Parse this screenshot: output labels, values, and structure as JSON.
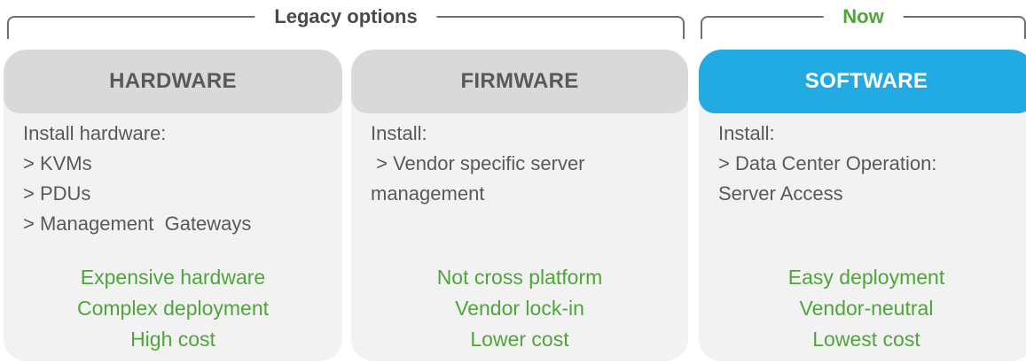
{
  "groups": {
    "legacy_label": "Legacy options",
    "now_label": "Now"
  },
  "cards": [
    {
      "title": "HARDWARE",
      "lines": [
        "Install hardware:",
        "> KVMs",
        "> PDUs",
        "> Management  Gateways"
      ],
      "benefits": [
        "Expensive hardware",
        "Complex deployment",
        "High cost"
      ]
    },
    {
      "title": "FIRMWARE",
      "lines": [
        "Install:",
        " > Vendor specific server",
        "management"
      ],
      "benefits": [
        "Not cross platform",
        "Vendor lock-in",
        "Lower cost"
      ]
    },
    {
      "title": "SOFTWARE",
      "lines": [
        "Install:",
        "> Data Center Operation:",
        "Server Access"
      ],
      "benefits": [
        "Easy deployment",
        "Vendor-neutral",
        "Lowest cost"
      ]
    }
  ],
  "colors": {
    "accent_blue": "#22abe3",
    "benefit_green": "#4ea63a",
    "header_grey": "#d9d9d9",
    "card_bg": "#f2f2f2",
    "text_grey": "#595959"
  }
}
